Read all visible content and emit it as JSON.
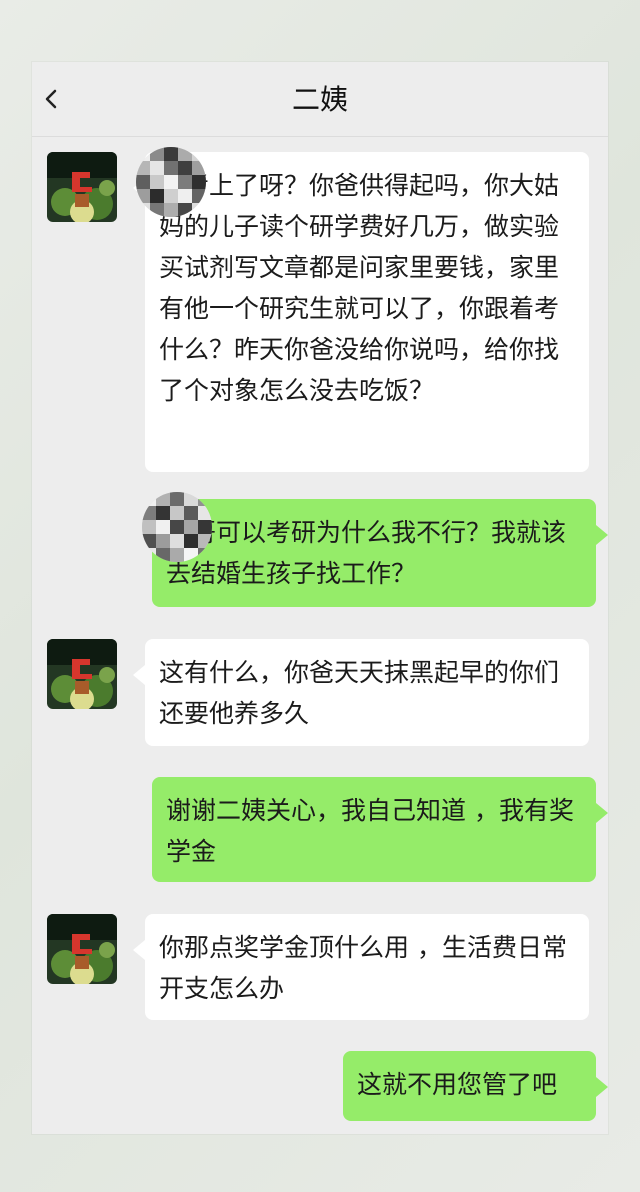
{
  "header": {
    "title": "二姨"
  },
  "messages": [
    {
      "side": "left",
      "text": "读考上了呀？你爸供得起吗，你大姑妈的儿子读个研学费好几万，做实验买试剂写文章都是问家里要钱，家里有他一个研究生就可以了，你跟着考什么？昨天你爸没给你说吗，给你找了个对象怎么没去吃饭？"
    },
    {
      "side": "right",
      "text": "表哥可以考研为什么我不行？我就该去结婚生孩子找工作？"
    },
    {
      "side": "left",
      "text": "这有什么，你爸天天抹黑起早的你们还要他养多久"
    },
    {
      "side": "right",
      "text": "谢谢二姨关心，我自己知道 ，我有奖学金"
    },
    {
      "side": "left",
      "text": "你那点奖学金顶什么用 ，生活费日常开支怎么办"
    },
    {
      "side": "right",
      "text": "这就不用您管了吧"
    }
  ],
  "icons": {
    "back": "chevron-left-icon"
  },
  "colors": {
    "background": "#ededed",
    "sent_bubble": "#95ec69",
    "received_bubble": "#ffffff"
  }
}
